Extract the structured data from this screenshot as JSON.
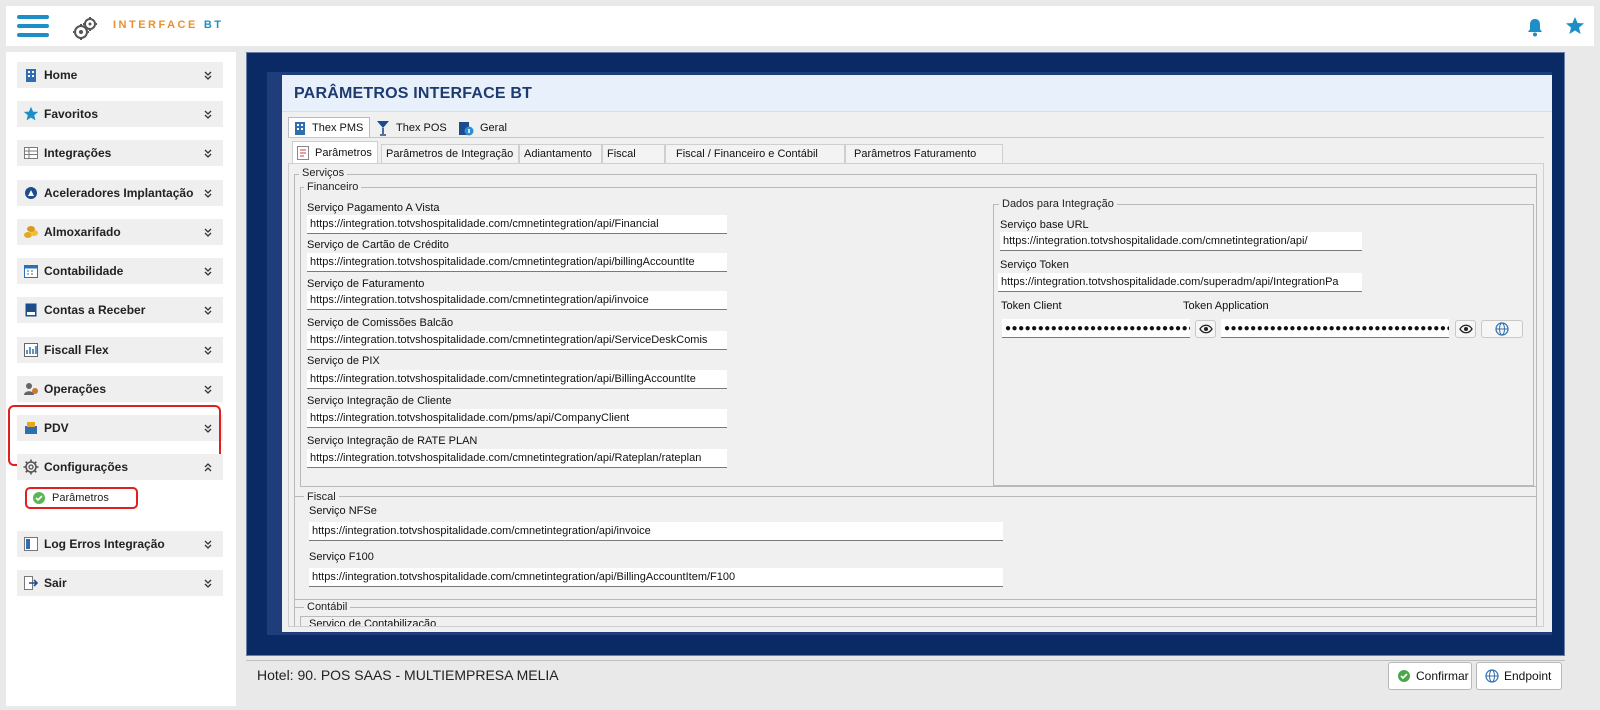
{
  "header": {
    "brand_main": "INTERFACE",
    "brand_accent": "BT",
    "menu_icon": "hamburger-icon",
    "logo_icon": "gears-icon",
    "notifications_icon": "bell-icon",
    "favorites_icon": "star-icon",
    "accent_color": "#1e8fc6",
    "brand_color": "#e6922f"
  },
  "sidebar": {
    "items": [
      {
        "label": "Home",
        "icon": "building-icon"
      },
      {
        "label": "Favoritos",
        "icon": "star-icon"
      },
      {
        "label": "Integrações",
        "icon": "table-icon"
      },
      {
        "label": "Aceleradores Implantação",
        "icon": "rocket-icon"
      },
      {
        "label": "Almoxarifado",
        "icon": "coins-icon"
      },
      {
        "label": "Contabilidade",
        "icon": "calendar-icon"
      },
      {
        "label": "Contas a Receber",
        "icon": "document-icon"
      },
      {
        "label": "Fiscall Flex",
        "icon": "chart-icon"
      },
      {
        "label": "Operações",
        "icon": "users-icon"
      },
      {
        "label": "PDV",
        "icon": "register-icon"
      },
      {
        "label": "Configurações",
        "icon": "gear-icon",
        "expanded": true
      },
      {
        "label": "Log Erros Integração",
        "icon": "log-icon"
      },
      {
        "label": "Sair",
        "icon": "exit-icon"
      }
    ],
    "sub_item": {
      "label": "Parâmetros",
      "icon": "check-circle-icon"
    }
  },
  "form": {
    "title": "PARÂMETROS INTERFACE BT",
    "tabs": [
      {
        "label": "Thex PMS",
        "icon": "building-icon",
        "active": true
      },
      {
        "label": "Thex POS",
        "icon": "cocktail-icon"
      },
      {
        "label": "Geral",
        "icon": "info-doc-icon"
      }
    ],
    "subtabs": [
      {
        "label": "Parâmetros",
        "icon": "document-icon",
        "active": true
      },
      {
        "label": "Parâmetros de Integração"
      },
      {
        "label": "Adiantamento"
      },
      {
        "label": "Fiscal"
      },
      {
        "label": "Fiscal / Financeiro e Contábil"
      },
      {
        "label": "Parâmetros Faturamento"
      }
    ],
    "servicos_legend": "Serviços",
    "financeiro": {
      "legend": "Financeiro",
      "fields": [
        {
          "label": "Serviço Pagamento A Vista",
          "value": "https://integration.totvshospitalidade.com/cmnetintegration/api/Financial"
        },
        {
          "label": "Serviço de Cartão de Crédito",
          "value": "https://integration.totvshospitalidade.com/cmnetintegration/api/billingAccountIte"
        },
        {
          "label": "Serviço de Faturamento",
          "value": "https://integration.totvshospitalidade.com/cmnetintegration/api/invoice"
        },
        {
          "label": "Serviço de Comissões Balcão",
          "value": "https://integration.totvshospitalidade.com/cmnetintegration/api/ServiceDeskComis"
        },
        {
          "label": "Serviço de PIX",
          "value": "https://integration.totvshospitalidade.com/cmnetintegration/api/BillingAccountIte"
        },
        {
          "label": "Serviço Integração de Cliente",
          "value": "https://integration.totvshospitalidade.com/pms/api/CompanyClient"
        },
        {
          "label": "Serviço Integração de RATE PLAN",
          "value": "https://integration.totvshospitalidade.com/cmnetintegration/api/Rateplan/rateplan"
        }
      ]
    },
    "dados_integracao": {
      "legend": "Dados para Integração",
      "base_url_label": "Serviço base URL",
      "base_url_value": "https://integration.totvshospitalidade.com/cmnetintegration/api/",
      "token_label": "Serviço Token",
      "token_value": "https://integration.totvshospitalidade.com/superadm/api/IntegrationPa",
      "token_client_label": "Token Client",
      "token_client_value": "●●●●●●●●●●●●●●●●●●●●●●●●●●●●●●●●●●●●",
      "token_app_label": "Token Application",
      "token_app_value": "●●●●●●●●●●●●●●●●●●●●●●●●●●●●●●●●●●●●●●●●●●●●●●●●●●●●●●●●●●"
    },
    "fiscal": {
      "legend": "Fiscal",
      "nfse_label": "Serviço NFSe",
      "nfse_value": "https://integration.totvshospitalidade.com/cmnetintegration/api/invoice",
      "f100_label": "Serviço F100",
      "f100_value": "https://integration.totvshospitalidade.com/cmnetintegration/api/BillingAccountItem/F100"
    },
    "contabil": {
      "legend": "Contábil",
      "label": "Serviço de Contabilização"
    }
  },
  "footer": {
    "hotel": "Hotel: 90. POS SAAS - MULTIEMPRESA MELIA",
    "confirm_label": "Confirmar",
    "endpoint_label": "Endpoint"
  }
}
